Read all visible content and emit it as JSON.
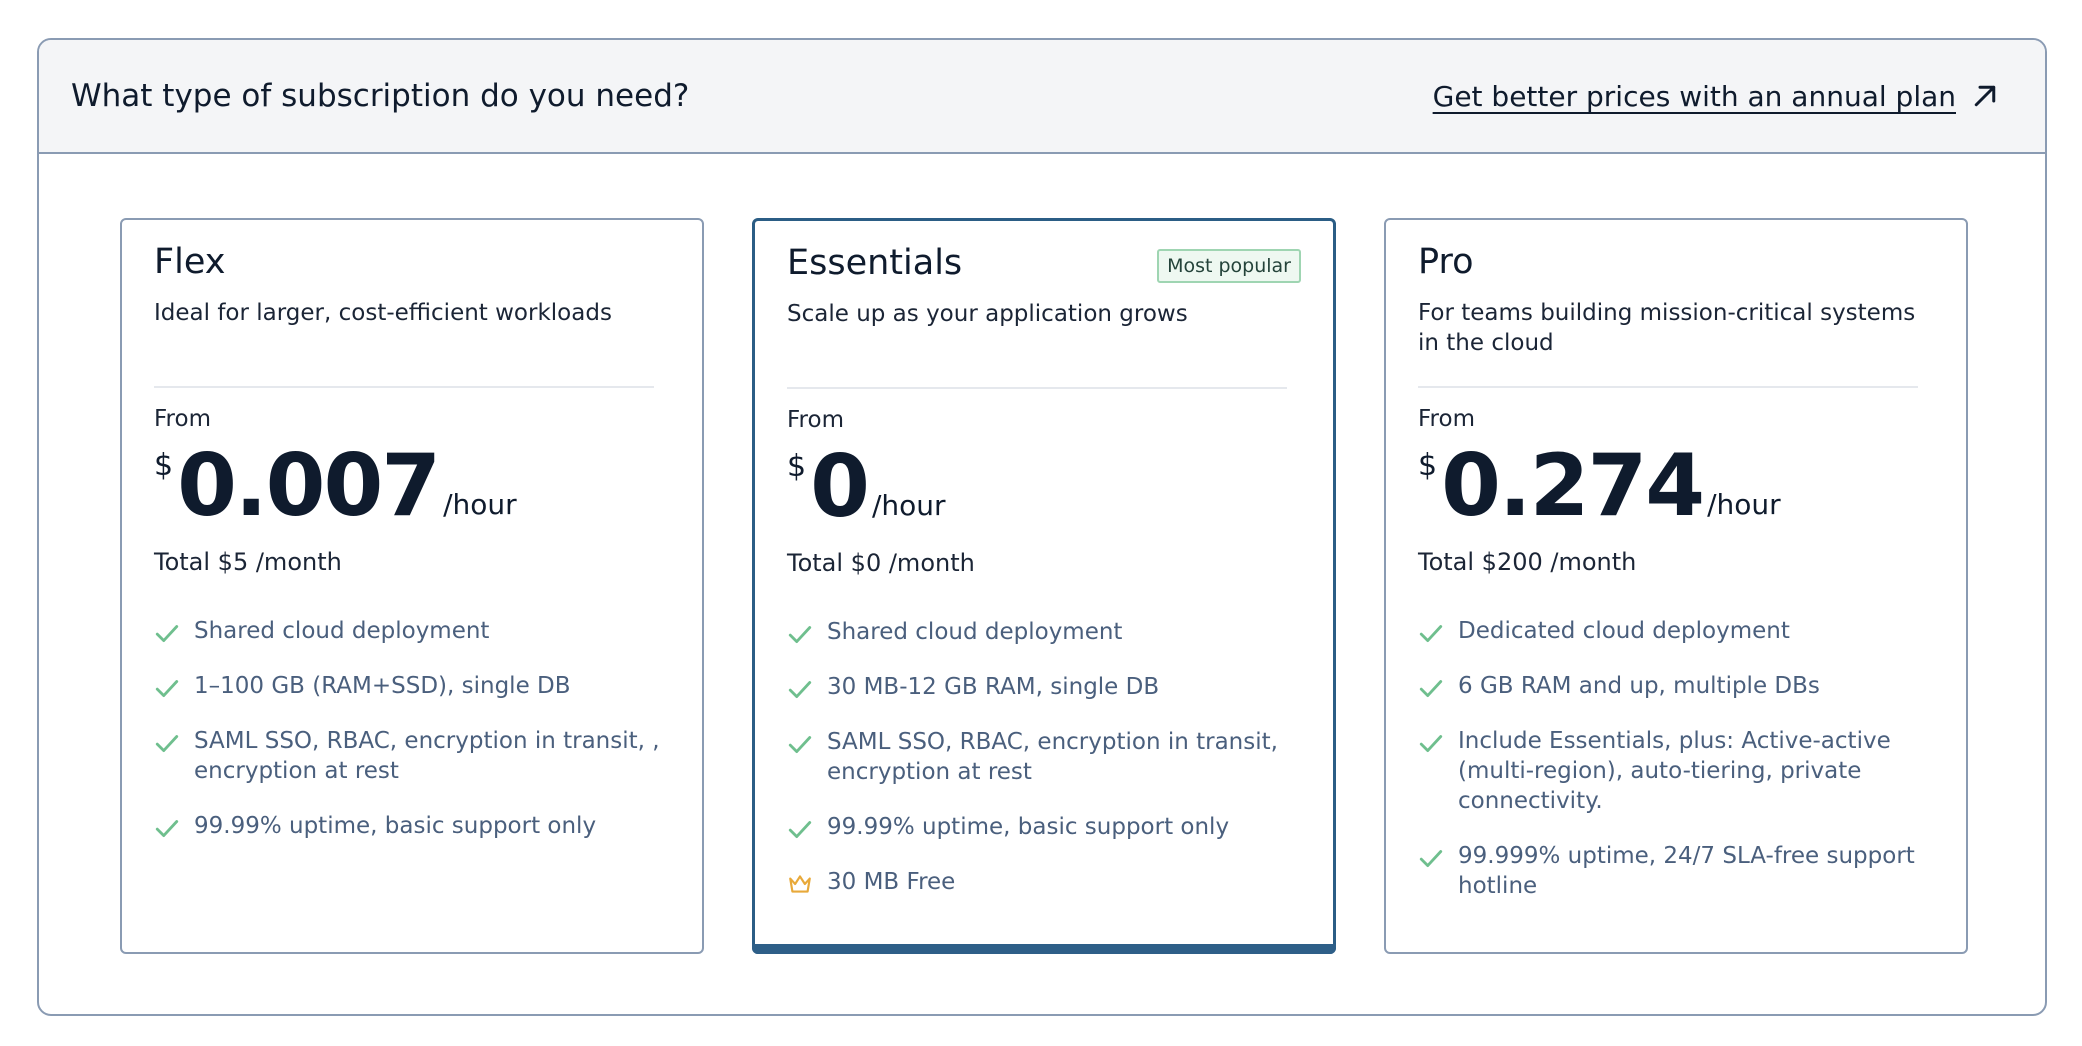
{
  "header": {
    "title": "What type of subscription do you need?",
    "annual_link": "Get better prices with an annual plan"
  },
  "plans": [
    {
      "name": "Flex",
      "badge": "",
      "description": "Ideal for larger, cost-efficient workloads",
      "from_label": "From",
      "currency": "$",
      "price": "0.007",
      "unit": "/hour",
      "total": "Total $5 /month",
      "features": [
        {
          "icon": "check-icon",
          "text": "Shared cloud deployment"
        },
        {
          "icon": "check-icon",
          "text": "1–100 GB (RAM+SSD), single DB"
        },
        {
          "icon": "check-icon",
          "text": "SAML SSO, RBAC, encryption in transit, , encryption at rest"
        },
        {
          "icon": "check-icon",
          "text": "99.99% uptime, basic support only"
        }
      ]
    },
    {
      "name": "Essentials",
      "badge": "Most popular",
      "description": "Scale up as your application grows",
      "from_label": "From",
      "currency": "$",
      "price": "0",
      "unit": "/hour",
      "total": "Total $0 /month",
      "features": [
        {
          "icon": "check-icon",
          "text": "Shared cloud deployment"
        },
        {
          "icon": "check-icon",
          "text": "30 MB-12 GB RAM, single DB"
        },
        {
          "icon": "check-icon",
          "text": "SAML SSO, RBAC, encryption in transit, encryption at rest"
        },
        {
          "icon": "check-icon",
          "text": "99.99% uptime, basic support only"
        },
        {
          "icon": "crown-icon",
          "text": "30 MB Free"
        }
      ]
    },
    {
      "name": "Pro",
      "badge": "",
      "description": "For teams building mission-critical systems in the cloud",
      "from_label": "From",
      "currency": "$",
      "price": "0.274",
      "unit": "/hour",
      "total": "Total $200 /month",
      "features": [
        {
          "icon": "check-icon",
          "text": "Dedicated cloud deployment"
        },
        {
          "icon": "check-icon",
          "text": "6 GB RAM and up, multiple DBs"
        },
        {
          "icon": "check-icon",
          "text": "Include Essentials, plus: Active-active (multi-region), auto-tiering, private connectivity."
        },
        {
          "icon": "check-icon",
          "text": "99.999% uptime, 24/7 SLA-free support hotline"
        }
      ]
    }
  ],
  "colors": {
    "check": "#6fbf8e",
    "crown": "#e8a93a",
    "featured_border": "#2b5d85",
    "accent_bar": "#2e5f88"
  }
}
